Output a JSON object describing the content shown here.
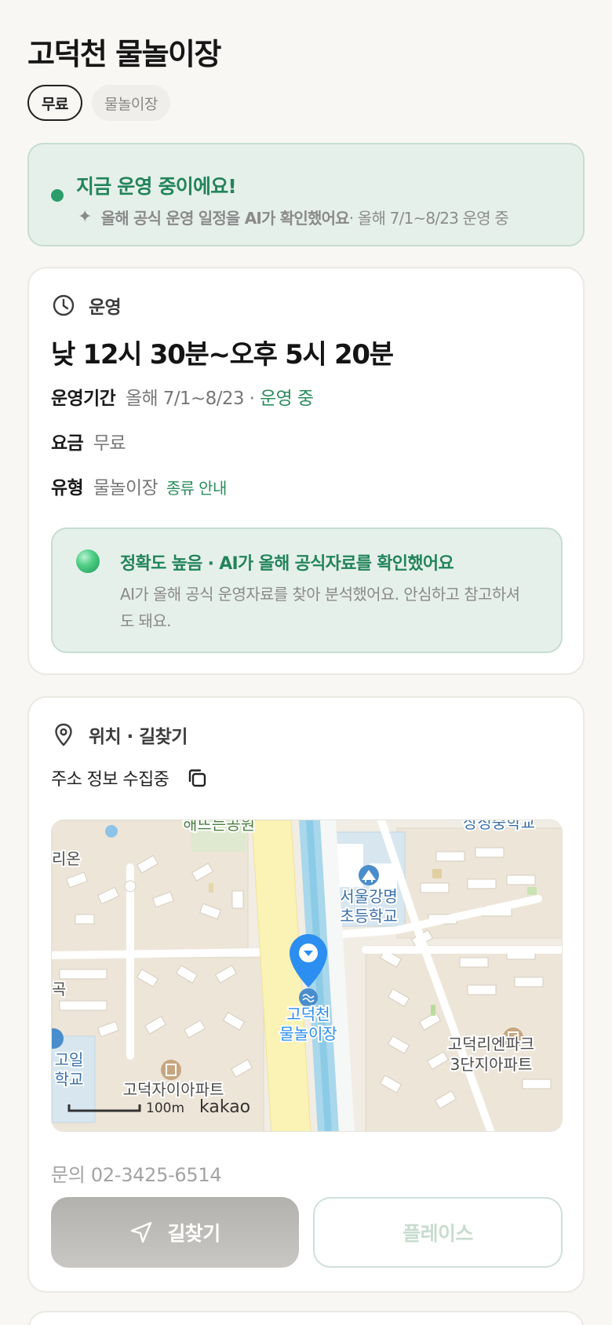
{
  "header": {
    "title": "고덕천 물놀이장",
    "chips": [
      "무료",
      "물놀이장"
    ]
  },
  "status": {
    "title": "지금 운영 중이에요!",
    "sub_bold": "올해 공식 운영 일정을 AI가 확인했어요",
    "sub_rest": " · 올해 7/1~8/23 운영 중",
    "accent": "#23845a"
  },
  "hours_card": {
    "section_label": "운영",
    "hours": "낮 12시 30분~오후 5시 20분",
    "period_key": "운영기간",
    "period_value": "올해 7/1~8/23 · ",
    "period_status": "운영 중",
    "fee_key": "요금",
    "fee_value": "무료",
    "type_key": "유형",
    "type_value": "물놀이장",
    "type_link": "종류 안내",
    "accuracy_title": "정확도 높음 · AI가 올해 공식자료를 확인했어요",
    "accuracy_text": "AI가 올해 공식 운영자료를 찾아 분석했어요. 안심하고 참고하셔도 돼요."
  },
  "location_card": {
    "section_label": "위치 · 길찾기",
    "address": "주소 정보 수집중",
    "map": {
      "labels": {
        "park": "해뜨는공원",
        "school_top": "상정중학교",
        "left_edge": "리온",
        "school": "서울강명초등학교",
        "school_line1": "서울강명",
        "school_line2": "초등학교",
        "marker_line1": "고덕천",
        "marker_line2": "물놀이장",
        "apt_right_line1": "고덕리엔파크",
        "apt_right_line2": "3단지아파트",
        "left_school_line1": "고일",
        "left_school_line2": "학교",
        "apt_left": "고덕자이아파트",
        "left_mark": "곡",
        "scale": "100m",
        "brand": "kakao"
      }
    },
    "phone": "문의 02-3425-6514",
    "directions_label": "길찾기",
    "place_label": "플레이스"
  }
}
